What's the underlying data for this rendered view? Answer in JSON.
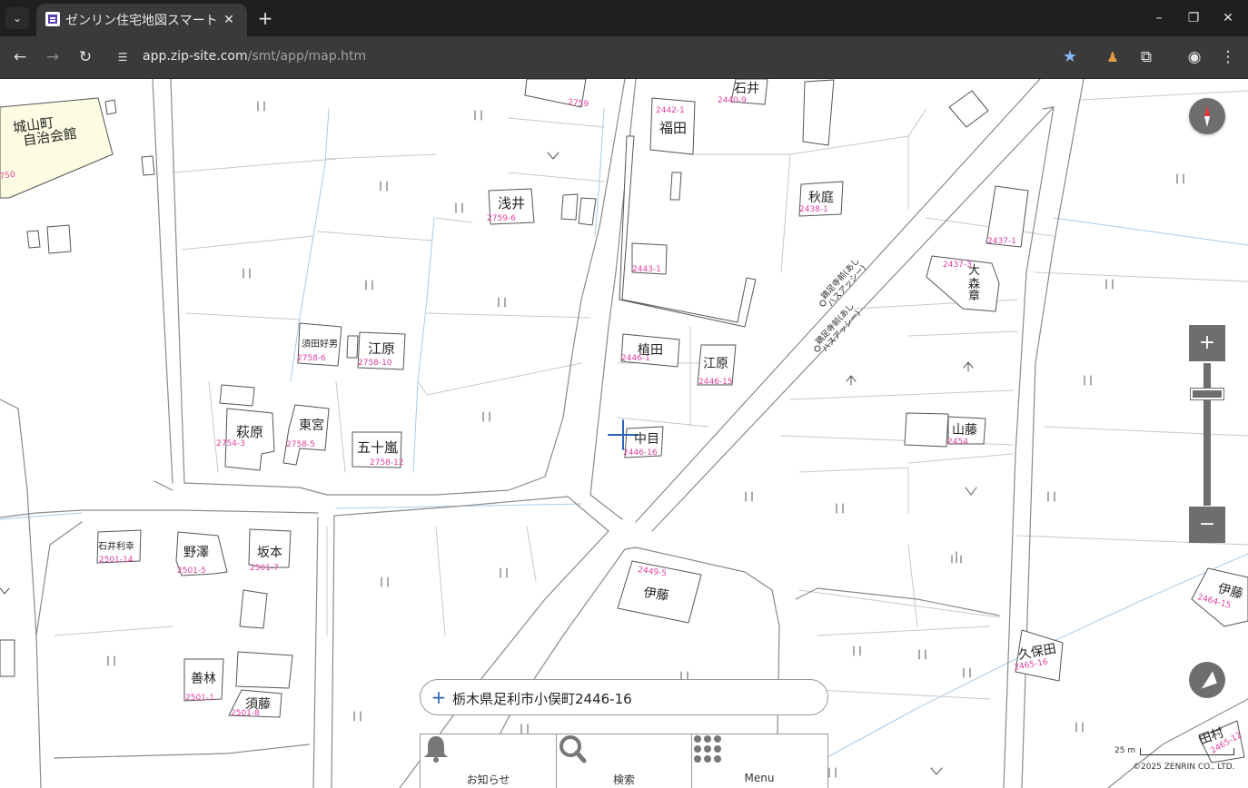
{
  "browser": {
    "tab_title": "ゼンリン住宅地図スマート",
    "url_host": "app.zip-site.com",
    "url_path": "/smt/app/map.htm"
  },
  "map": {
    "labels": [
      {
        "text": "城山町",
        "type": "name"
      },
      {
        "text": "自治会館",
        "type": "name"
      },
      {
        "text": "750",
        "type": "number"
      },
      {
        "text": "浅井",
        "type": "name"
      },
      {
        "text": "2759-6",
        "type": "number"
      },
      {
        "text": "2759",
        "type": "number"
      },
      {
        "text": "須田好男",
        "type": "name"
      },
      {
        "text": "2758-6",
        "type": "number"
      },
      {
        "text": "江原",
        "type": "name"
      },
      {
        "text": "2758-10",
        "type": "number"
      },
      {
        "text": "萩原",
        "type": "name"
      },
      {
        "text": "2754-3",
        "type": "number"
      },
      {
        "text": "東宮",
        "type": "name"
      },
      {
        "text": "2758-5",
        "type": "number"
      },
      {
        "text": "五十嵐",
        "type": "name"
      },
      {
        "text": "2758-12",
        "type": "number"
      },
      {
        "text": "福田",
        "type": "name"
      },
      {
        "text": "2442-1",
        "type": "number"
      },
      {
        "text": "石井",
        "type": "name"
      },
      {
        "text": "2440-9",
        "type": "number"
      },
      {
        "text": "秋庭",
        "type": "name"
      },
      {
        "text": "2438-1",
        "type": "number"
      },
      {
        "text": "2443-1",
        "type": "number"
      },
      {
        "text": "2437-1",
        "type": "number"
      },
      {
        "text": "2437-3",
        "type": "number"
      },
      {
        "text": "大",
        "type": "name"
      },
      {
        "text": "森",
        "type": "name"
      },
      {
        "text": "章",
        "type": "name"
      },
      {
        "text": "植田",
        "type": "name"
      },
      {
        "text": "2446-1",
        "type": "number"
      },
      {
        "text": "江原",
        "type": "name"
      },
      {
        "text": "2446-15",
        "type": "number"
      },
      {
        "text": "中目",
        "type": "name"
      },
      {
        "text": "2446-16",
        "type": "number"
      },
      {
        "text": "山藤",
        "type": "name"
      },
      {
        "text": "2454",
        "type": "number"
      },
      {
        "text": "石井利幸",
        "type": "name"
      },
      {
        "text": "2501-14",
        "type": "number"
      },
      {
        "text": "野澤",
        "type": "name"
      },
      {
        "text": "2501-5",
        "type": "number"
      },
      {
        "text": "坂本",
        "type": "name"
      },
      {
        "text": "2501-7",
        "type": "number"
      },
      {
        "text": "伊藤",
        "type": "name"
      },
      {
        "text": "2449-5",
        "type": "number"
      },
      {
        "text": "善林",
        "type": "name"
      },
      {
        "text": "2501-1",
        "type": "number"
      },
      {
        "text": "須藤",
        "type": "name"
      },
      {
        "text": "2501-8",
        "type": "number"
      },
      {
        "text": "久保田",
        "type": "name"
      },
      {
        "text": "2465-16",
        "type": "number"
      },
      {
        "text": "伊藤",
        "type": "name"
      },
      {
        "text": "2464-15",
        "type": "number"
      },
      {
        "text": "田村",
        "type": "name"
      },
      {
        "text": "2465-12",
        "type": "number"
      }
    ],
    "road_labels": [
      "鶏足寺前(あし",
      "ハスアッシー)",
      "鶏足寺前(あし",
      "ハスアッシー)"
    ]
  },
  "scale_label": "25 m",
  "copyright": "©2025 ZENRIN CO., LTD.",
  "address": "栃木県足利市小俣町2446-16",
  "bottom_menu": {
    "notice": "お知らせ",
    "search": "検索",
    "menu": "Menu"
  },
  "colors": {
    "parcel_number": "#e040a0",
    "road_line": "#8a8a8a",
    "boundary": "#c8c8c8",
    "water": "#a8cbe8",
    "control": "#6e6e6e",
    "public_building": "#fdfde3"
  }
}
